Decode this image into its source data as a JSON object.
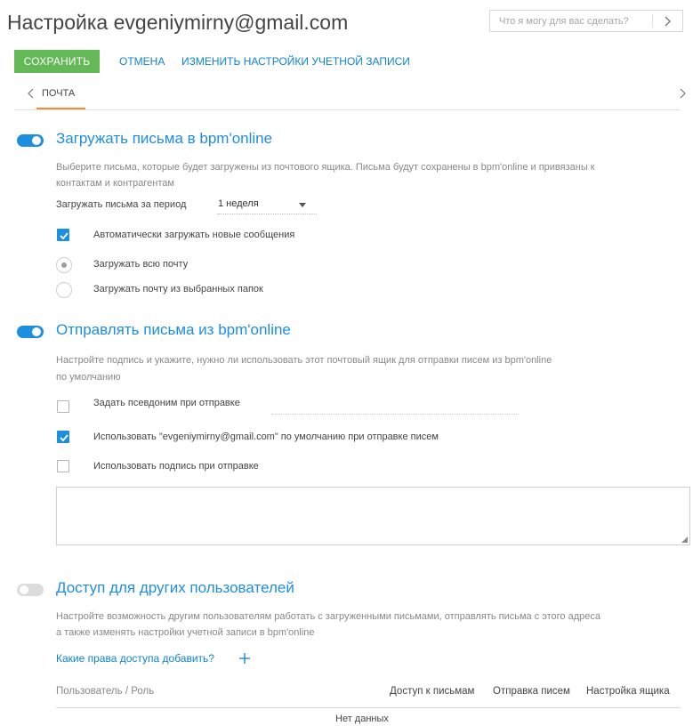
{
  "header": {
    "title": "Настройка evgeniymirny@gmail.com",
    "search_placeholder": "Что я могу для вас сделать?"
  },
  "toolbar": {
    "save_label": "СОХРАНИТЬ",
    "cancel_label": "ОТМЕНА",
    "account_settings_label": "ИЗМЕНИТЬ НАСТРОЙКИ УЧЕТНОЙ ЗАПИСИ"
  },
  "tabs": [
    {
      "label": "ПОЧТА",
      "active": true
    }
  ],
  "load_section": {
    "toggle_on": true,
    "title": "Загружать письма в bpm'online",
    "desc_line1": "Выберите письма, которые будет загружены из почтового ящика. Письма будут сохранены в bpm'online и привязаны к",
    "desc_line2": "контактам и контрагентам",
    "period_label": "Загружать письма за период",
    "period_value": "1 неделя",
    "auto_load_label": "Автоматически загружать новые сообщения",
    "auto_load_checked": true,
    "radio_all_label": "Загружать всю почту",
    "radio_folders_label": "Загружать почту из выбранных папок",
    "selected_radio": "all"
  },
  "send_section": {
    "toggle_on": true,
    "title": "Отправлять письма из bpm'online",
    "desc_line1": "Настройте подпись и укажите, нужно ли использовать этот почтовый ящик для отправки писем из bpm'online",
    "desc_line2": "по умолчанию",
    "alias_label": "Задать псевдоним при отправке",
    "alias_checked": false,
    "alias_value": "",
    "default_label": "Использовать \"evgeniymirny@gmail.com\" по умолчанию при отправке писем",
    "default_checked": true,
    "signature_label": "Использовать подпись при отправке",
    "signature_checked": false,
    "signature_text": ""
  },
  "access_section": {
    "toggle_on": false,
    "title": "Доступ для других пользователей",
    "desc_line1": "Настройте возможность другим пользователям работать с загруженными письмами, отправлять письма с этого адреса",
    "desc_line2": "а также изменять настройки  учетной записи в bpm'online",
    "rights_link": "Какие права доступа добавить?",
    "columns": {
      "user_role": "Пользователь / Роль",
      "mail_access": "Доступ к письмам",
      "sending": "Отправка писем",
      "mailbox_settings": "Настройка ящика"
    },
    "empty_text": "Нет данных"
  },
  "colors": {
    "accent_blue": "#1e8ede",
    "link_blue": "#0e84cf",
    "save_green": "#64b956",
    "tab_orange": "#f28c2b"
  },
  "icons": [
    "chevron-right-icon",
    "chevron-left-icon",
    "check-icon",
    "plus-icon",
    "resize-grip-icon"
  ]
}
